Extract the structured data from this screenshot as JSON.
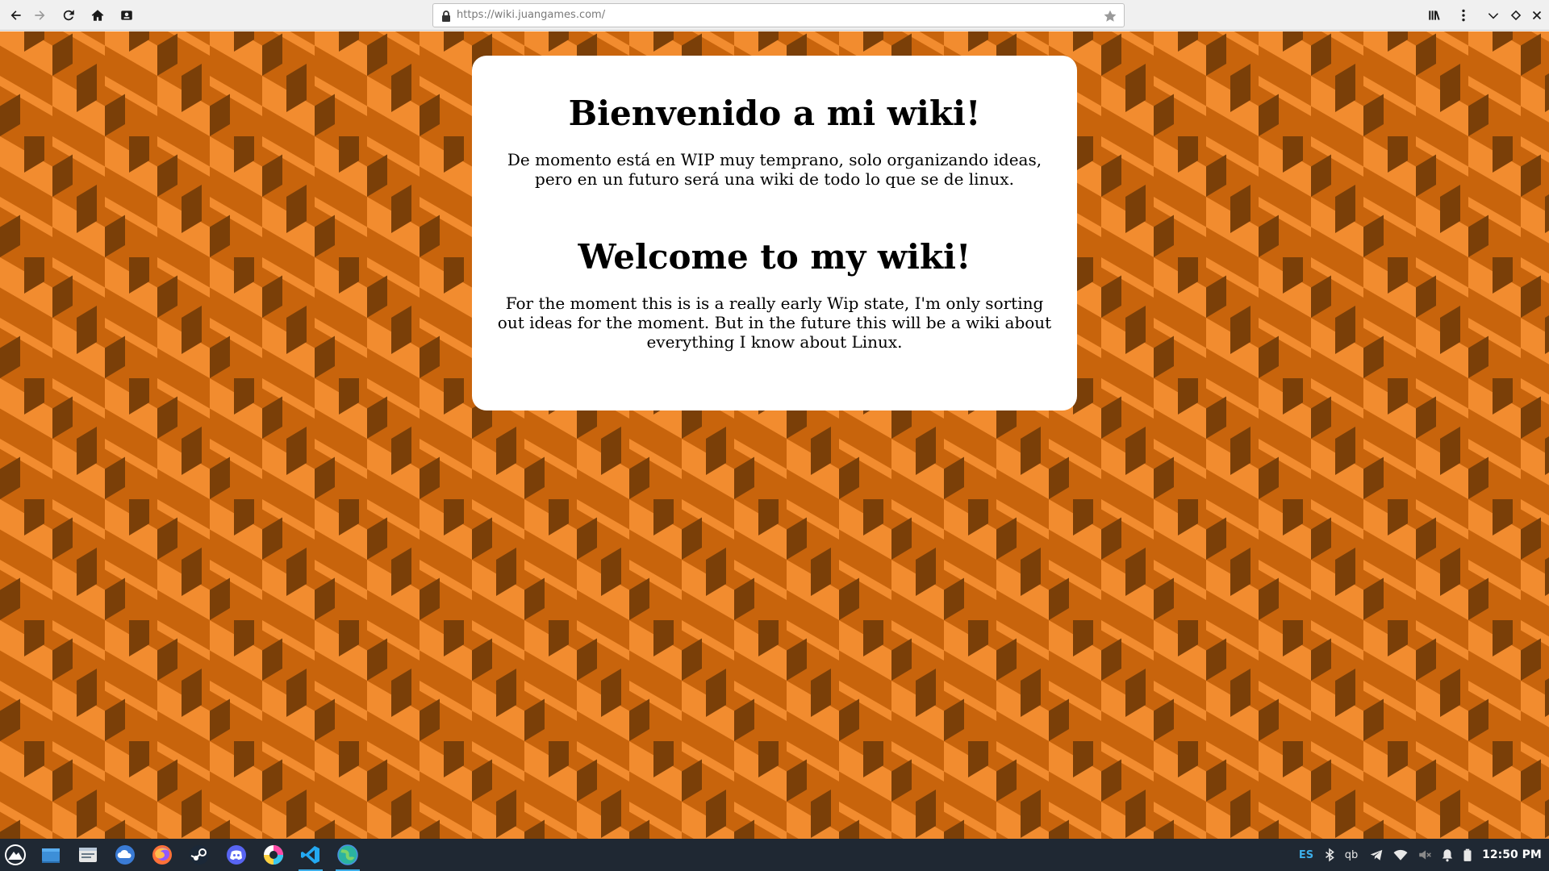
{
  "browser": {
    "url": "https://wiki.juangames.com/",
    "buttons": {
      "back_icon": "back-arrow-icon",
      "forward_icon": "forward-arrow-icon",
      "reload_icon": "reload-icon",
      "home_icon": "home-icon",
      "extension_icon": "extension-icon",
      "library_icon": "library-icon",
      "menu_icon": "kebab-menu-icon",
      "minimize_icon": "chevron-down-icon",
      "maximize_icon": "diamond-icon",
      "close_icon": "close-icon"
    }
  },
  "colors": {
    "pattern_light": "#f28c2f",
    "pattern_mid": "#c8640c",
    "pattern_dark": "#7a3f08",
    "card_background": "#ffffff",
    "taskbar_background": "#1f2833",
    "accent": "#3daee9"
  },
  "content": {
    "heading_es": "Bienvenido a mi wiki!",
    "paragraph_es": "De momento está en WIP muy temprano, solo organizando ideas, pero en un futuro será una wiki de todo lo que se de linux.",
    "heading_en": "Welcome to my wiki!",
    "paragraph_en": "For the moment this is is a really early Wip state, I'm only sorting out ideas for the moment. But in the future this will be a wiki about everything I know about Linux."
  },
  "taskbar": {
    "apps": [
      {
        "name": "app-launcher-icon"
      },
      {
        "name": "show-desktop-icon"
      },
      {
        "name": "file-manager-icon"
      },
      {
        "name": "cloud-app-icon"
      },
      {
        "name": "firefox-icon"
      },
      {
        "name": "steam-icon"
      },
      {
        "name": "discord-icon"
      },
      {
        "name": "color-app-icon"
      },
      {
        "name": "vscode-icon"
      },
      {
        "name": "browser-globe-icon"
      }
    ],
    "tray": {
      "language": "ES",
      "qb": "qb",
      "time": "12:50 PM"
    }
  }
}
